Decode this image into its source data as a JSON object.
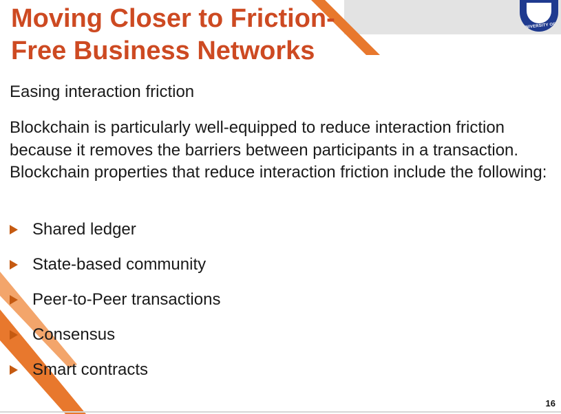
{
  "title": {
    "line1": "Moving Closer to Friction-",
    "line2": "Free Business Networks"
  },
  "subtitle": "Easing interaction friction",
  "paragraph": "Blockchain is particularly well-equipped to reduce interaction friction because it removes the barriers between participants in a transaction. Blockchain properties that reduce interaction friction include the following:",
  "bullets": [
    "Shared ledger",
    "State-based community",
    "Peer-to-Peer transactions",
    "Consensus",
    "Smart contracts"
  ],
  "logo": {
    "text": "UNIVERSITY OF ASIA P"
  },
  "page_number": "16",
  "colors": {
    "title": "#cd4a22",
    "accent_orange": "#e8782d",
    "accent_light": "#f3a56b",
    "bullet": "#c55a11",
    "header_band": "#e3e3e3",
    "logo_blue": "#1f3a8f"
  }
}
